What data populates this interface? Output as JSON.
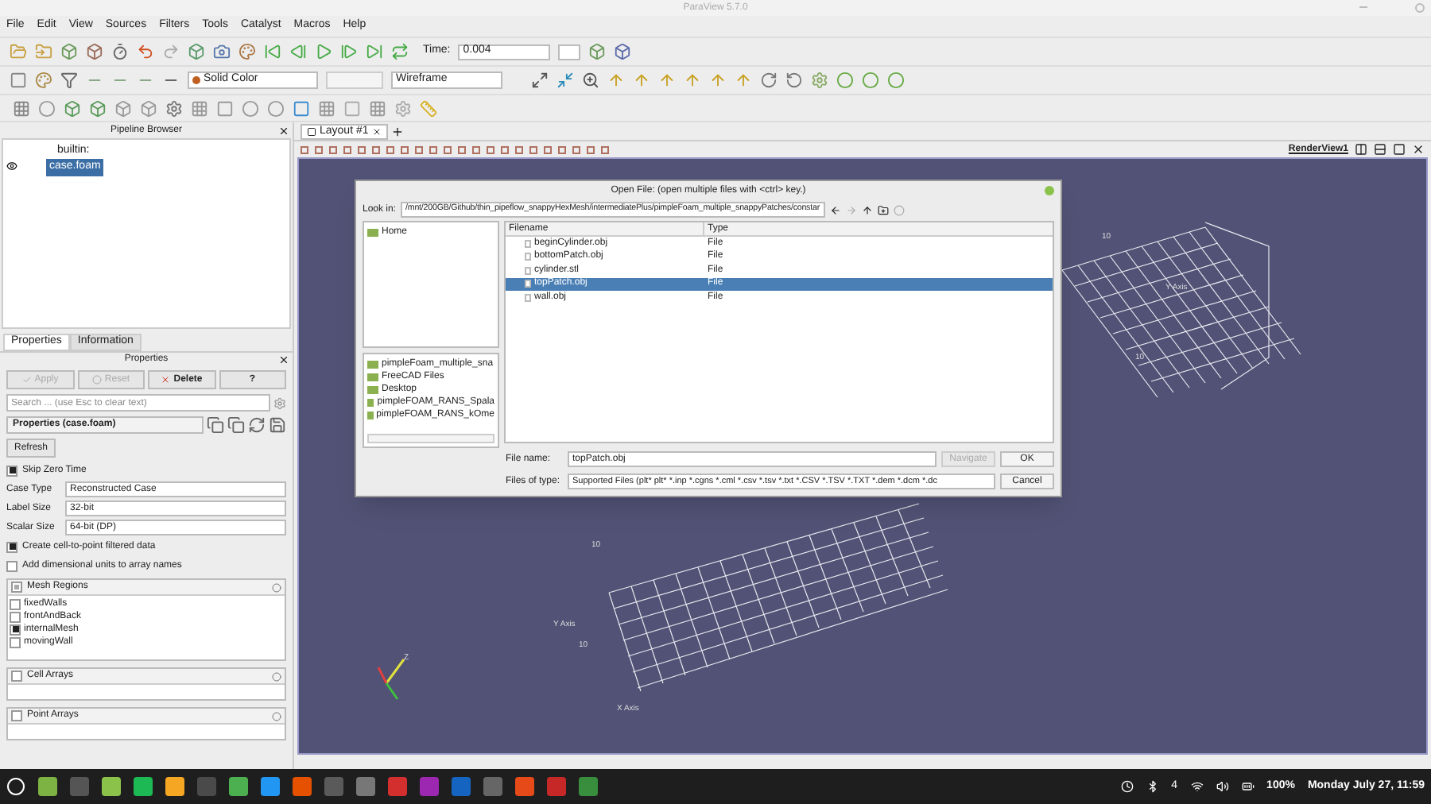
{
  "window": {
    "title": "ParaView 5.7.0"
  },
  "menu": [
    "File",
    "Edit",
    "View",
    "Sources",
    "Filters",
    "Tools",
    "Catalyst",
    "Macros",
    "Help"
  ],
  "time": {
    "label": "Time:",
    "value": "0.004"
  },
  "combos": {
    "coloring": "Solid Color",
    "representation": "Wireframe"
  },
  "pipeline": {
    "title": "Pipeline Browser",
    "root": {
      "label": "builtin:",
      "children": [
        {
          "label": "case.foam",
          "selected": true,
          "visible": true
        }
      ]
    }
  },
  "panel_tabs": [
    {
      "label": "Properties",
      "selected": true
    },
    {
      "label": "Information",
      "selected": false
    }
  ],
  "properties": {
    "title": "Properties",
    "buttons": [
      {
        "label": "Apply",
        "disabled": true
      },
      {
        "label": "Reset",
        "disabled": true
      },
      {
        "label": "Delete",
        "disabled": false
      },
      {
        "label": "?",
        "disabled": false
      }
    ],
    "search": {
      "placeholder": "Search ... (use Esc to clear text)"
    },
    "section": "Properties (case.foam)",
    "refresh": "Refresh",
    "rows": [
      {
        "kind": "checkbox",
        "label": "Skip Zero Time",
        "checked": true
      },
      {
        "kind": "combo",
        "label": "Case Type",
        "value": "Reconstructed Case"
      },
      {
        "kind": "combo",
        "label": "Label Size",
        "value": "32-bit"
      },
      {
        "kind": "combo",
        "label": "Scalar Size",
        "value": "64-bit (DP)"
      },
      {
        "kind": "checkbox",
        "label": "Create cell-to-point filtered data",
        "checked": true
      },
      {
        "kind": "checkbox",
        "label": "Add dimensional units to array names",
        "checked": false
      }
    ],
    "lists": [
      {
        "title": "Mesh Regions",
        "checked": true,
        "items": [
          {
            "label": "fixedWalls",
            "checked": false
          },
          {
            "label": "frontAndBack",
            "checked": false
          },
          {
            "label": "internalMesh",
            "checked": true
          },
          {
            "label": "movingWall",
            "checked": false
          }
        ]
      },
      {
        "title": "Cell Arrays",
        "checked": false
      },
      {
        "title": "Point Arrays",
        "checked": false
      }
    ]
  },
  "layout_tabs": [
    {
      "label": "Layout #1",
      "selected": true
    }
  ],
  "view": {
    "name": "RenderView1",
    "labels": [
      "10",
      "Y Axis",
      "10",
      "10",
      "Y Axis",
      "10",
      "X Axis",
      "Z"
    ]
  },
  "dialog": {
    "title": "Open File:  (open multiple files with <ctrl> key.)",
    "look_in_label": "Look in:",
    "path": "/mnt/200GB/Github/thin_pipeflow_snappyHexMesh/intermediatePlus/pimpleFoam_multiple_snappyPatches/constar",
    "places": [
      "Home"
    ],
    "bookmarks": [
      "pimpleFoam_multiple_sna",
      "FreeCAD Files",
      "Desktop",
      "pimpleFOAM_RANS_Spala",
      "pimpleFOAM_RANS_kOme"
    ],
    "columns": [
      "Filename",
      "Type"
    ],
    "files": [
      {
        "name": "beginCylinder.obj",
        "type": "File",
        "selected": false
      },
      {
        "name": "bottomPatch.obj",
        "type": "File",
        "selected": false
      },
      {
        "name": "cylinder.stl",
        "type": "File",
        "selected": false
      },
      {
        "name": "topPatch.obj",
        "type": "File",
        "selected": true
      },
      {
        "name": "wall.obj",
        "type": "File",
        "selected": false
      }
    ],
    "file_name_label": "File name:",
    "file_name": "topPatch.obj",
    "navigate": {
      "label": "Navigate",
      "disabled": true
    },
    "ok": "OK",
    "file_type_label": "Files of type:",
    "file_type": "Supported Files (plt* plt* *.inp *.cgns *.cml *.csv *.tsv *.txt *.CSV *.TSV *.TXT *.dem *.dcm *.dc",
    "cancel": "Cancel"
  },
  "taskbar": {
    "tray_count": "4",
    "battery": "100%",
    "clock": "Monday July 27, 11:59"
  }
}
